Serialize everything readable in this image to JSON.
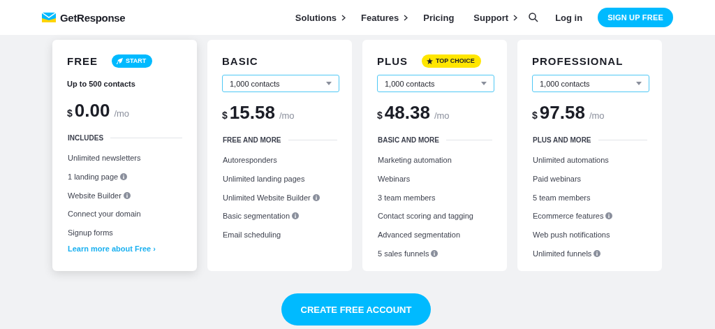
{
  "header": {
    "logo": "GetResponse",
    "nav": [
      {
        "label": "Solutions",
        "has_menu": true
      },
      {
        "label": "Features",
        "has_menu": true
      },
      {
        "label": "Pricing",
        "has_menu": false
      },
      {
        "label": "Support",
        "has_menu": true
      }
    ],
    "login": "Log in",
    "signup": "SIGN UP FREE"
  },
  "plans": [
    {
      "name": "FREE",
      "highlighted": true,
      "badge": {
        "kind": "start",
        "label": "START"
      },
      "contacts": {
        "kind": "text",
        "label": "Up to 500 contacts"
      },
      "currency": "$",
      "amount": "0.00",
      "period": "/mo",
      "section": "INCLUDES",
      "features": [
        {
          "text": "Unlimited newsletters",
          "info": false
        },
        {
          "text": "1 landing page",
          "info": true
        },
        {
          "text": "Website Builder",
          "info": true
        },
        {
          "text": "Connect your domain",
          "info": false
        },
        {
          "text": "Signup forms",
          "info": false
        }
      ],
      "link": "Learn more about Free ›"
    },
    {
      "name": "BASIC",
      "highlighted": false,
      "contacts": {
        "kind": "dropdown",
        "label": "1,000 contacts"
      },
      "currency": "$",
      "amount": "15.58",
      "period": "/mo",
      "section": "FREE AND MORE",
      "features": [
        {
          "text": "Autoresponders",
          "info": false
        },
        {
          "text": "Unlimited landing pages",
          "info": false
        },
        {
          "text": "Unlimited Website Builder",
          "info": true
        },
        {
          "text": "Basic segmentation",
          "info": true
        },
        {
          "text": "Email scheduling",
          "info": false
        }
      ]
    },
    {
      "name": "PLUS",
      "highlighted": false,
      "badge": {
        "kind": "top",
        "label": "TOP CHOICE"
      },
      "contacts": {
        "kind": "dropdown",
        "label": "1,000 contacts"
      },
      "currency": "$",
      "amount": "48.38",
      "period": "/mo",
      "section": "BASIC AND MORE",
      "features": [
        {
          "text": "Marketing automation",
          "info": false
        },
        {
          "text": "Webinars",
          "info": false
        },
        {
          "text": "3 team members",
          "info": false
        },
        {
          "text": "Contact scoring and tagging",
          "info": false
        },
        {
          "text": "Advanced segmentation",
          "info": false
        },
        {
          "text": "5 sales funnels",
          "info": true
        }
      ]
    },
    {
      "name": "PROFESSIONAL",
      "highlighted": false,
      "contacts": {
        "kind": "dropdown",
        "label": "1,000 contacts"
      },
      "currency": "$",
      "amount": "97.58",
      "period": "/mo",
      "section": "PLUS AND MORE",
      "features": [
        {
          "text": "Unlimited automations",
          "info": false
        },
        {
          "text": "Paid webinars",
          "info": false
        },
        {
          "text": "5 team members",
          "info": false
        },
        {
          "text": "Ecommerce features",
          "info": true
        },
        {
          "text": "Web push notifications",
          "info": false
        },
        {
          "text": "Unlimited funnels",
          "info": true
        }
      ]
    }
  ],
  "cta": "CREATE FREE ACCOUNT"
}
